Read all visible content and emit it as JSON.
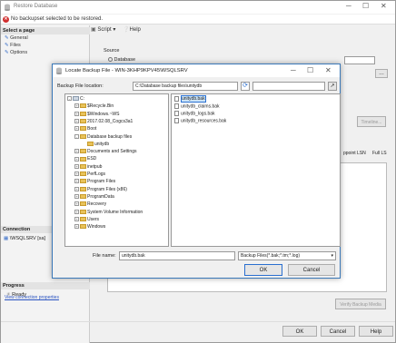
{
  "outer": {
    "title": "Restore Database",
    "warning": "No backupset selected to be restored.",
    "select_page": "Select a page",
    "pages": [
      "General",
      "Files",
      "Options"
    ],
    "toolbar": {
      "script": "Script",
      "help": "Help"
    },
    "connection_head": "Connection",
    "connection_value": "\\WSQLSRV [sa]",
    "view_connection": "View connection properties",
    "progress_head": "Progress",
    "progress_status": "Ready",
    "source_label": "Source",
    "database_label": "Database",
    "timeline_label": "Timeline...",
    "lsn_headers": [
      "ppoint LSN",
      "Full LS"
    ],
    "verify_button": "Verify Backup Media",
    "ok": "OK",
    "cancel": "Cancel",
    "help": "Help"
  },
  "dialog": {
    "title": "Locate Backup File - WIN-3KHP9KPV45\\WSQLSRV",
    "location_label": "Backup File location:",
    "location_value": "C:\\Database backup files\\unitydb",
    "tree": [
      {
        "label": "C:",
        "depth": 0,
        "exp": "-"
      },
      {
        "label": "$Recycle.Bin",
        "depth": 1,
        "exp": "+"
      },
      {
        "label": "$Windows.~WS",
        "depth": 1,
        "exp": "+"
      },
      {
        "label": "2017.02.08_Cogcs3a1",
        "depth": 1,
        "exp": "+"
      },
      {
        "label": "Boot",
        "depth": 1,
        "exp": "+"
      },
      {
        "label": "Database backup files",
        "depth": 1,
        "exp": "-"
      },
      {
        "label": "unitydb",
        "depth": 2,
        "exp": ""
      },
      {
        "label": "Documents and Settings",
        "depth": 1,
        "exp": "+"
      },
      {
        "label": "ESD",
        "depth": 1,
        "exp": "+"
      },
      {
        "label": "inetpub",
        "depth": 1,
        "exp": "+"
      },
      {
        "label": "PerfLogs",
        "depth": 1,
        "exp": "+"
      },
      {
        "label": "Program Files",
        "depth": 1,
        "exp": "+"
      },
      {
        "label": "Program Files (x86)",
        "depth": 1,
        "exp": "+"
      },
      {
        "label": "ProgramData",
        "depth": 1,
        "exp": "+"
      },
      {
        "label": "Recovery",
        "depth": 1,
        "exp": "+"
      },
      {
        "label": "System Volume Information",
        "depth": 1,
        "exp": "+"
      },
      {
        "label": "Users",
        "depth": 1,
        "exp": "+"
      },
      {
        "label": "Windows",
        "depth": 1,
        "exp": "+"
      }
    ],
    "files": [
      "unitydb.bak",
      "unitydb_claims.bak",
      "unitydb_logs.bak",
      "unitydb_resources.bak"
    ],
    "selected_file_index": 0,
    "file_name_label": "File name:",
    "file_name_value": "unitydb.bak",
    "filter_value": "Backup Files(*.bak;*.tm;*.log)",
    "ok": "OK",
    "cancel": "Cancel"
  }
}
